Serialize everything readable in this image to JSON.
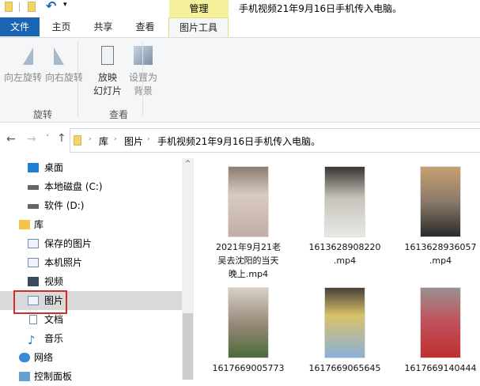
{
  "title_bar": {
    "manage_tab": "管理",
    "window_title": "手机视频21年9月16日手机传入电脑。"
  },
  "ribbon_tabs": [
    {
      "label": "文件"
    },
    {
      "label": "主页"
    },
    {
      "label": "共享"
    },
    {
      "label": "查看"
    },
    {
      "label": "图片工具"
    }
  ],
  "ribbon": {
    "rotate_left": "向左旋转",
    "rotate_right": "向右旋转",
    "group_rotate": "旋转",
    "slideshow_1": "放映",
    "slideshow_2": "幻灯片",
    "set_bg_1": "设置为",
    "set_bg_2": "背景",
    "group_view": "查看"
  },
  "address": {
    "crumbs": [
      "库",
      "图片",
      "手机视频21年9月16日手机传入电脑。"
    ]
  },
  "nav": [
    {
      "label": "桌面"
    },
    {
      "label": "本地磁盘 (C:)"
    },
    {
      "label": "软件 (D:)"
    },
    {
      "label": "库"
    },
    {
      "label": "保存的图片"
    },
    {
      "label": "本机照片"
    },
    {
      "label": "视频"
    },
    {
      "label": "图片"
    },
    {
      "label": "文档"
    },
    {
      "label": "音乐"
    },
    {
      "label": "网络"
    },
    {
      "label": "控制面板"
    }
  ],
  "files": [
    {
      "line1": "2021年9月21老",
      "line2": "吴去沈阳的当天",
      "line3": "晚上.mp4",
      "color": "#c9b7a8"
    },
    {
      "line1": "1613628908220",
      "line2": ".mp4",
      "color": "#bcb5a8"
    },
    {
      "line1": "1613628936057",
      "line2": ".mp4",
      "color": "#8a7a6a"
    },
    {
      "line1": "1617669005773",
      "color": "#9a8a7a"
    },
    {
      "line1": "1617669065645",
      "color": "#d9c36a"
    },
    {
      "line1": "1617669140444",
      "color": "#b0585a"
    }
  ],
  "colors": {
    "file_tab": "#1a64b4",
    "manage": "#f4f09c",
    "selection": "#d9d9d9",
    "highlight_box": "#d32a2a"
  }
}
